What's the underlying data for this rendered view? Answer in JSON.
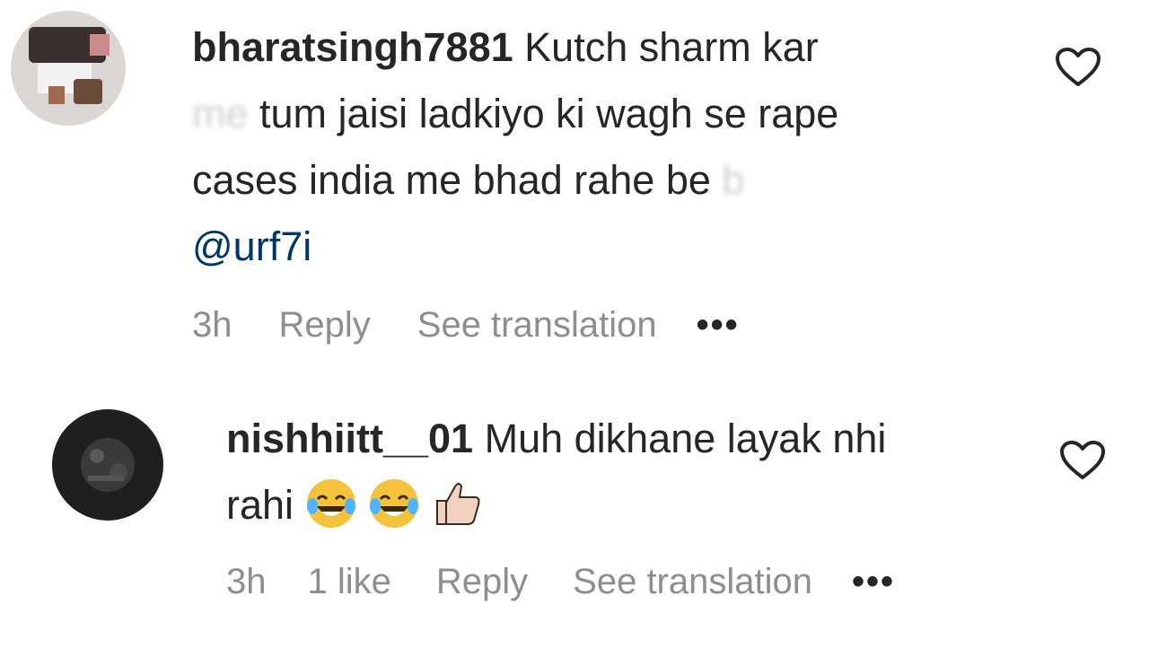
{
  "comments": [
    {
      "username": "bharatsingh7881",
      "text_line1": "Kutch sharm kar",
      "text_hidden_1": "me",
      "text_line2": "tum jaisi ladkiyo ki wagh se rape",
      "text_line3": "cases india me bhad rahe be",
      "text_hidden_2": "b",
      "mention": "@urf7i",
      "time": "3h",
      "reply_label": "Reply",
      "translate_label": "See translation",
      "more_label": "•••"
    },
    {
      "username": "nishhiitt__01",
      "text_line1": "Muh dikhane layak nhi",
      "text_line2": "rahi",
      "emojis": [
        "face-with-tears-of-joy-icon",
        "face-with-tears-of-joy-icon",
        "thumbs-up-icon"
      ],
      "time": "3h",
      "likes": "1 like",
      "reply_label": "Reply",
      "translate_label": "See translation",
      "more_label": "•••"
    }
  ],
  "colors": {
    "text": "#262626",
    "secondary": "#8e8e8e",
    "mention": "#00376b"
  }
}
